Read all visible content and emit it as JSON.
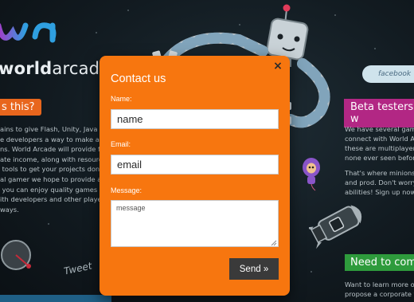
{
  "background": {
    "logo_text_bold": "world",
    "logo_text_regular": "arcade",
    "left_heading": "s this?",
    "left_paragraph_1": "ains to give Flash, Unity, Java a\ne developers a way to make a liv\nns. World Arcade will provide fac\nate income, along with resource\n tools to get your projects done.",
    "left_paragraph_2": "al gamer we hope to provide a g\n you can enjoy quality games wh\nith developers and other players\nways.",
    "facebook_label": "facebook",
    "right_heading": "Beta testers w",
    "right_paragraph_1": "We have several gamer\nconnect with World Ar\nthese are multiplayer S\nnone ever seen before.",
    "right_paragraph_2": "That's where minions w\nand prod. Don't worry,\nabilities! Sign up now b",
    "right_heading_2": "Need to com",
    "right_paragraph_3": "Want to learn more or\npropose a corporate ta",
    "tweet_label": "Tweet"
  },
  "modal": {
    "title": "Contact us",
    "close_label": "×",
    "name_label": "Name:",
    "name_placeholder": "name",
    "email_label": "Email:",
    "email_placeholder": "email",
    "message_label": "Message:",
    "message_placeholder": "message",
    "send_label": "Send »"
  },
  "colors": {
    "modal_orange": "#f7760f",
    "left_heading_orange": "#e8661d",
    "right_heading_magenta": "#b22784",
    "right_heading_green": "#2e9b3c",
    "send_button": "#3a3a3a"
  }
}
